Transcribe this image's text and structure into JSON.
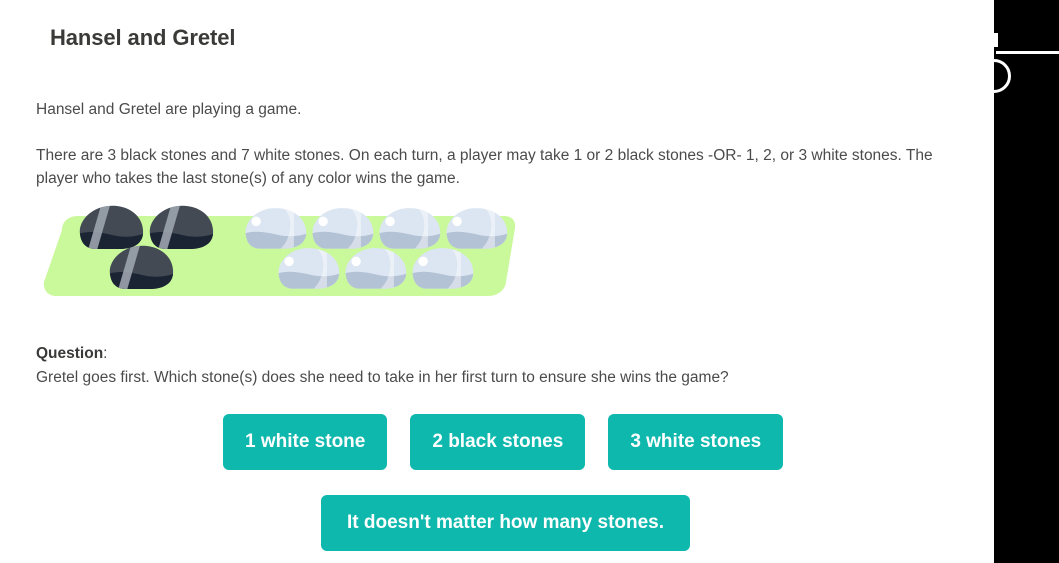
{
  "page": {
    "title": "Hansel and Gretel",
    "paragraphs": [
      "Hansel and Gretel are playing a game.",
      "There are 3 black stones and 7 white stones. On each turn, a player may take 1 or 2 black stones -OR- 1, 2, or 3 white stones. The player who takes the last stone(s) of any color wins the game."
    ]
  },
  "illustration": {
    "name": "stones-on-grass",
    "grass_color": "#c9f99b",
    "black_stone_count": 3,
    "white_stone_count": 7,
    "black_stone_body_color": "#434a54",
    "black_stone_base_color": "#1b2433",
    "black_stone_stripe_color": "#9aa2ad",
    "white_stone_body_color": "#dce6f2",
    "white_stone_base_color": "#b4c2d6",
    "white_stone_highlight_color": "#ffffff"
  },
  "question": {
    "label": "Question",
    "colon": ":",
    "text": "Gretel goes first. Which stone(s) does she need to take in her first turn to ensure she wins the game?"
  },
  "answers": {
    "accent_color": "#0fb8ad",
    "text_color": "#ffffff",
    "row1": [
      {
        "label": "1 white stone"
      },
      {
        "label": "2 black stones"
      },
      {
        "label": "3 white stones"
      }
    ],
    "row2": [
      {
        "label": "It doesn't matter how many stones."
      }
    ]
  },
  "right_panel": {
    "background_color": "#000000",
    "marks": [
      {
        "name": "tick-mark"
      },
      {
        "name": "horizontal-rule"
      },
      {
        "name": "circle-outline"
      }
    ]
  }
}
